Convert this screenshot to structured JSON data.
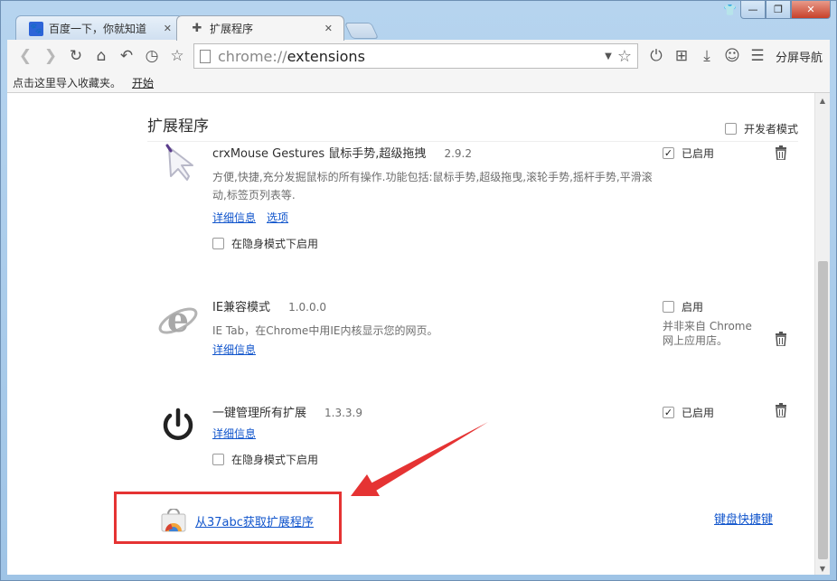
{
  "window": {
    "controls": [
      "—",
      "❐",
      "✕"
    ]
  },
  "tabs": [
    {
      "title": "百度一下，你就知道",
      "icon": "baidu-paw-icon",
      "active": false
    },
    {
      "title": "扩展程序",
      "icon": "puzzle-icon",
      "active": true
    }
  ],
  "toolbar": {
    "url_scheme": "chrome://",
    "url_path": "extensions",
    "split_nav_label": "分屏导航"
  },
  "bookmarks_bar": {
    "prompt": "点击这里导入收藏夹。",
    "start_link": "开始"
  },
  "page": {
    "title": "扩展程序",
    "dev_mode_label": "开发者模式",
    "dev_mode_checked": false
  },
  "extensions": [
    {
      "name": "crxMouse Gestures 鼠标手势,超级拖拽",
      "version": "2.9.2",
      "description": "方便,快捷,充分发掘鼠标的所有操作.功能包括:鼠标手势,超级拖曳,滚轮手势,摇杆手势,平滑滚动,标签页列表等.",
      "details_link": "详细信息",
      "options_link": "选项",
      "incognito_label": "在隐身模式下启用",
      "enable_label": "已启用",
      "enabled": true,
      "icon": "mouse-gesture-arrow-icon"
    },
    {
      "name": "IE兼容模式",
      "version": "1.0.0.0",
      "description": "IE Tab，在Chrome中用IE内核显示您的网页。",
      "details_link": "详细信息",
      "enable_label": "启用",
      "enabled": false,
      "note": "并非来自 Chrome 网上应用店。",
      "icon": "ie-logo-icon"
    },
    {
      "name": "一键管理所有扩展",
      "version": "1.3.3.9",
      "details_link": "详细信息",
      "incognito_label": "在隐身模式下启用",
      "enable_label": "已启用",
      "enabled": true,
      "icon": "power-icon"
    }
  ],
  "footer": {
    "get_more_link": "从37abc获取扩展程序",
    "keyboard_shortcuts_link": "键盘快捷键"
  },
  "annotation": {
    "color": "#e53333"
  }
}
